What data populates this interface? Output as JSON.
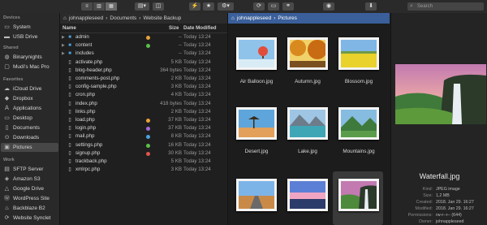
{
  "toolbar": {
    "search_placeholder": "Search",
    "view_buttons": [
      "list-view-icon",
      "columns-view-icon",
      "grid-view-icon"
    ],
    "tool_icons": [
      "lightning-icon",
      "star-icon",
      "gear-icon",
      "sync-icon",
      "terminal-icon",
      "link-icon",
      "eye-icon",
      "download-icon"
    ]
  },
  "sidebar": {
    "sections": [
      {
        "title": "Devices",
        "items": [
          {
            "label": "System",
            "icon": "disk-icon"
          },
          {
            "label": "USB Drive",
            "icon": "usb-icon"
          }
        ]
      },
      {
        "title": "Shared",
        "items": [
          {
            "label": "Binarynights",
            "icon": "network-icon"
          },
          {
            "label": "Mudi's Mac Pro",
            "icon": "computer-icon"
          }
        ]
      },
      {
        "title": "Favorites",
        "items": [
          {
            "label": "iCloud Drive",
            "icon": "cloud-icon"
          },
          {
            "label": "Dropbox",
            "icon": "dropbox-icon"
          },
          {
            "label": "Applications",
            "icon": "applications-icon"
          },
          {
            "label": "Desktop",
            "icon": "desktop-icon"
          },
          {
            "label": "Documents",
            "icon": "documents-icon"
          },
          {
            "label": "Downloads",
            "icon": "downloads-icon"
          },
          {
            "label": "Pictures",
            "icon": "pictures-icon",
            "selected": true
          }
        ]
      },
      {
        "title": "Work",
        "items": [
          {
            "label": "SFTP Server",
            "icon": "server-icon"
          },
          {
            "label": "Amazon S3",
            "icon": "s3-icon"
          },
          {
            "label": "Google Drive",
            "icon": "google-drive-icon"
          },
          {
            "label": "WordPress Site",
            "icon": "wordpress-icon"
          },
          {
            "label": "Backblaze B2",
            "icon": "backblaze-icon"
          },
          {
            "label": "Website Synclet",
            "icon": "sync-icon"
          }
        ]
      }
    ]
  },
  "left_pane": {
    "breadcrumb": [
      "johnappleseed",
      "Documents",
      "Website Backup"
    ],
    "columns": {
      "name": "Name",
      "size": "Size",
      "date": "Date Modified"
    },
    "rows": [
      {
        "name": "admin",
        "type": "folder",
        "size": "--",
        "date": "Today 13:24",
        "tag": "#e8a23a"
      },
      {
        "name": "content",
        "type": "folder",
        "size": "--",
        "date": "Today 13:24",
        "tag": "#5cbf4a"
      },
      {
        "name": "includes",
        "type": "folder",
        "size": "--",
        "date": "Today 13:24",
        "tag": ""
      },
      {
        "name": "activate.php",
        "type": "file",
        "size": "5 KB",
        "date": "Today 13:24",
        "tag": ""
      },
      {
        "name": "blog-header.php",
        "type": "file",
        "size": "364 bytes",
        "date": "Today 13:24",
        "tag": ""
      },
      {
        "name": "comments-post.php",
        "type": "file",
        "size": "2 KB",
        "date": "Today 13:24",
        "tag": ""
      },
      {
        "name": "config-sample.php",
        "type": "file",
        "size": "3 KB",
        "date": "Today 13:24",
        "tag": ""
      },
      {
        "name": "cron.php",
        "type": "file",
        "size": "4 KB",
        "date": "Today 13:24",
        "tag": ""
      },
      {
        "name": "index.php",
        "type": "file",
        "size": "418 bytes",
        "date": "Today 13:24",
        "tag": ""
      },
      {
        "name": "links.php",
        "type": "file",
        "size": "2 KB",
        "date": "Today 13:24",
        "tag": ""
      },
      {
        "name": "load.php",
        "type": "file",
        "size": "37 KB",
        "date": "Today 13:24",
        "tag": "#e8a23a"
      },
      {
        "name": "login.php",
        "type": "file",
        "size": "37 KB",
        "date": "Today 13:24",
        "tag": "#a36ad8"
      },
      {
        "name": "mail.php",
        "type": "file",
        "size": "8 KB",
        "date": "Today 13:24",
        "tag": "#4aa3df"
      },
      {
        "name": "settings.php",
        "type": "file",
        "size": "16 KB",
        "date": "Today 13:24",
        "tag": "#5cbf4a"
      },
      {
        "name": "signup.php",
        "type": "file",
        "size": "30 KB",
        "date": "Today 13:24",
        "tag": "#e0554a"
      },
      {
        "name": "trackback.php",
        "type": "file",
        "size": "5 KB",
        "date": "Today 13:24",
        "tag": ""
      },
      {
        "name": "xmlrpc.php",
        "type": "file",
        "size": "3 KB",
        "date": "Today 13:24",
        "tag": ""
      }
    ]
  },
  "right_pane": {
    "breadcrumb": [
      "johnappleseed",
      "Pictures"
    ],
    "images": [
      {
        "name": "Air Balloon.jpg",
        "scene": "balloon"
      },
      {
        "name": "Autumn.jpg",
        "scene": "autumn"
      },
      {
        "name": "Blossom.jpg",
        "scene": "blossom"
      },
      {
        "name": "Desert.jpg",
        "scene": "desert"
      },
      {
        "name": "Lake.jpg",
        "scene": "lake"
      },
      {
        "name": "Mountains.jpg",
        "scene": "mountains"
      },
      {
        "name": "",
        "scene": "road"
      },
      {
        "name": "",
        "scene": "sunset"
      },
      {
        "name": "",
        "scene": "waterfall",
        "selected": true
      }
    ]
  },
  "preview": {
    "title": "Waterfall.jpg",
    "meta": [
      {
        "key": "Kind:",
        "value": "JPEG image"
      },
      {
        "key": "Size:",
        "value": "1,2 MB"
      },
      {
        "key": "Created:",
        "value": "2018. Jan 29. 16:27"
      },
      {
        "key": "Modified:",
        "value": "2018. Jan 29. 16:27"
      },
      {
        "key": "Permissions:",
        "value": "rw-r--r-- (644)"
      },
      {
        "key": "Owner:",
        "value": "johnappleseed"
      }
    ]
  }
}
